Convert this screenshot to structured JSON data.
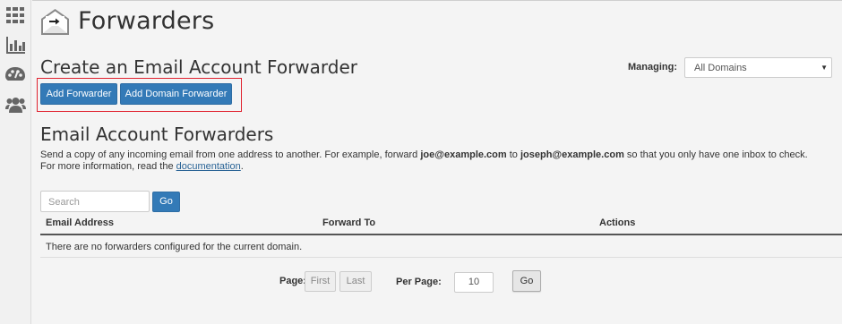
{
  "sidebar": {
    "items": [
      {
        "icon": "grid-icon"
      },
      {
        "icon": "bar-chart-icon"
      },
      {
        "icon": "palette-icon"
      },
      {
        "icon": "users-icon"
      }
    ]
  },
  "header": {
    "title": "Forwarders",
    "icon": "envelope-forward-icon"
  },
  "create_section": {
    "title": "Create an Email Account Forwarder",
    "add_forwarder_label": "Add Forwarder",
    "add_domain_forwarder_label": "Add Domain Forwarder"
  },
  "managing": {
    "label": "Managing:",
    "selected": "All Domains"
  },
  "list_section": {
    "title": "Email Account Forwarders",
    "desc_part1": "Send a copy of any incoming email from one address to another. For example, forward ",
    "example_from": "joe@example.com",
    "desc_part2": " to ",
    "example_to": "joseph@example.com",
    "desc_part3": " so that you only have one inbox to check. For more information, read the ",
    "doc_link": "documentation",
    "desc_part4": "."
  },
  "search": {
    "placeholder": "Search",
    "go_label": "Go"
  },
  "table": {
    "columns": [
      "Email Address",
      "Forward To",
      "Actions"
    ],
    "empty_message": "There are no forwarders configured for the current domain."
  },
  "pagination": {
    "page_label": "Page:",
    "first_label": "First",
    "last_label": "Last",
    "per_page_label": "Per Page:",
    "per_page_value": "10",
    "go_label": "Go"
  },
  "colors": {
    "primary": "#337ab7",
    "highlight": "#e0222f",
    "sidebar_icon": "#666666"
  }
}
